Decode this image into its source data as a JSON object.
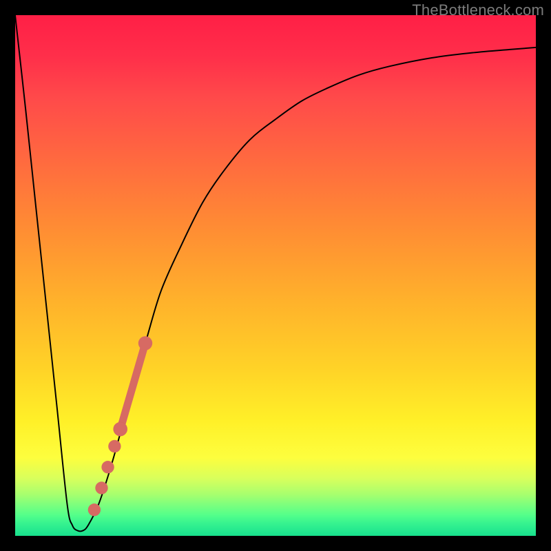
{
  "watermark": "TheBottleneck.com",
  "colors": {
    "frame": "#000000",
    "curve": "#000000",
    "marker_fill": "#d76a63",
    "marker_stroke": "#c9584f"
  },
  "chart_data": {
    "type": "line",
    "title": "",
    "xlabel": "",
    "ylabel": "",
    "xlim": [
      0,
      100
    ],
    "ylim": [
      0,
      100
    ],
    "series": [
      {
        "name": "bottleneck-curve",
        "x": [
          0,
          2,
          4,
          6,
          8,
          10,
          11,
          12,
          13,
          14,
          16,
          18,
          20,
          22,
          25,
          28,
          32,
          36,
          40,
          45,
          50,
          55,
          60,
          66,
          72,
          80,
          88,
          95,
          100
        ],
        "y": [
          100,
          82,
          63,
          44,
          25,
          6,
          2,
          1,
          1,
          2,
          6,
          12,
          19,
          27,
          37,
          47,
          56,
          64,
          70,
          76,
          80,
          83.5,
          86,
          88.5,
          90.2,
          91.8,
          92.8,
          93.4,
          93.8
        ]
      }
    ],
    "markers": [
      {
        "name": "marker-0",
        "x": 15.2,
        "y": 5.0,
        "r": 1.2
      },
      {
        "name": "marker-1",
        "x": 16.6,
        "y": 9.2,
        "r": 1.2
      },
      {
        "name": "marker-2",
        "x": 17.8,
        "y": 13.2,
        "r": 1.2
      },
      {
        "name": "marker-3",
        "x": 19.1,
        "y": 17.2,
        "r": 1.2
      },
      {
        "name": "segment-start",
        "x": 20.2,
        "y": 20.5,
        "r": 1.35
      },
      {
        "name": "segment-end",
        "x": 25.0,
        "y": 37.0,
        "r": 1.35
      }
    ],
    "thick_segment": {
      "from": 4,
      "to": 5
    }
  }
}
